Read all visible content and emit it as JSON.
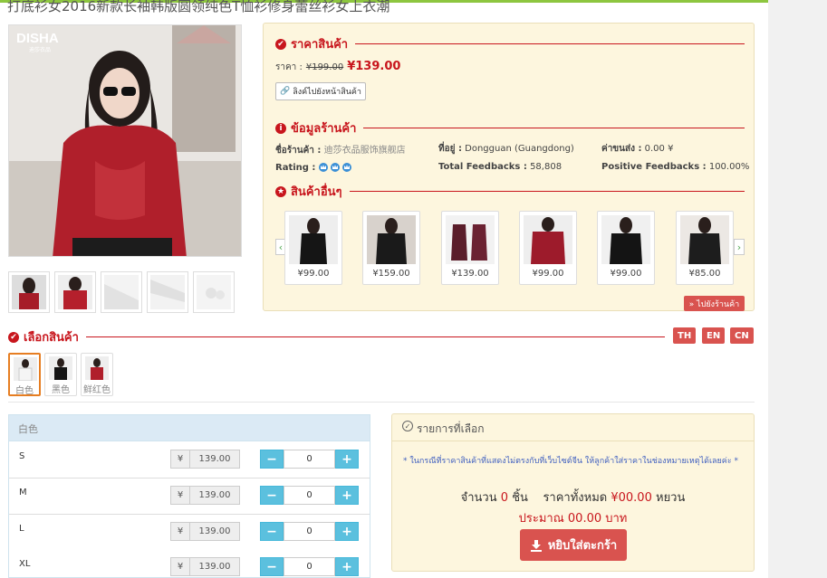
{
  "page_title": "打底衫女2016新款长袖韩版圆领纯色T恤衫修身蕾丝衫女上衣潮",
  "brand_logo": "DISHA",
  "brand_sub": "迪莎衣品",
  "price_section": {
    "title": "ราคาสินค้า",
    "label": "ราคา :",
    "old_price": "¥199.00",
    "new_price": "¥139.00",
    "link_button": "ลิงค์ไปยังหน้าสินค้า"
  },
  "store_section": {
    "title": "ข้อมูลร้านค้า",
    "shop_label": "ชื่อร้านค้า :",
    "shop_name": "迪莎衣品服饰旗舰店",
    "location_label": "ที่อยู่ :",
    "location": "Dongguan (Guangdong)",
    "shipping_label": "ค่าขนส่ง :",
    "shipping": "0.00 ¥",
    "rating_label": "Rating :",
    "total_feedbacks_label": "Total Feedbacks :",
    "total_feedbacks": "58,808",
    "positive_label": "Positive Feedbacks :",
    "positive": "100.00%"
  },
  "other_section": {
    "title": "สินค้าอื่นๆ",
    "goto_button": "» ไปยังร้านค้า",
    "products": [
      {
        "price": "¥99.00"
      },
      {
        "price": "¥159.00"
      },
      {
        "price": "¥139.00"
      },
      {
        "price": "¥99.00"
      },
      {
        "price": "¥99.00"
      },
      {
        "price": "¥85.00"
      }
    ]
  },
  "select_section": {
    "title": "เลือกสินค้า",
    "lang": [
      "TH",
      "EN",
      "CN"
    ],
    "options": [
      {
        "label": "白色"
      },
      {
        "label": "黑色"
      },
      {
        "label": "鲜红色"
      }
    ]
  },
  "size_table": {
    "header": "白色",
    "currency": "¥",
    "rows": [
      {
        "size": "S",
        "price": "139.00",
        "qty": "0"
      },
      {
        "size": "M",
        "price": "139.00",
        "qty": "0"
      },
      {
        "size": "L",
        "price": "139.00",
        "qty": "0"
      },
      {
        "size": "XL",
        "price": "139.00",
        "qty": "0"
      }
    ]
  },
  "selected": {
    "title": "รายการที่เลือก",
    "note": "* ในกรณีที่ราคาสินค้าที่แสดงไม่ตรงกับที่เว็บไซต์จีน ให้ลูกค้าใส่ราคาในช่องหมายเหตุได้เลยค่ะ *",
    "qty_label": "จำนวน",
    "qty": "0",
    "qty_unit": "ชิ้น",
    "total_label": "ราคาทั้งหมด",
    "total": "¥00.00",
    "total_unit": "หยวน",
    "approx": "ประมาณ 00.00 บาท",
    "cart_button": "หยิบใส่ตะกร้า"
  },
  "colors": {
    "accent_red": "#c8161d",
    "button_red": "#d9534f",
    "panel_bg": "#fdf6de",
    "info_blue": "#5bc0de"
  }
}
